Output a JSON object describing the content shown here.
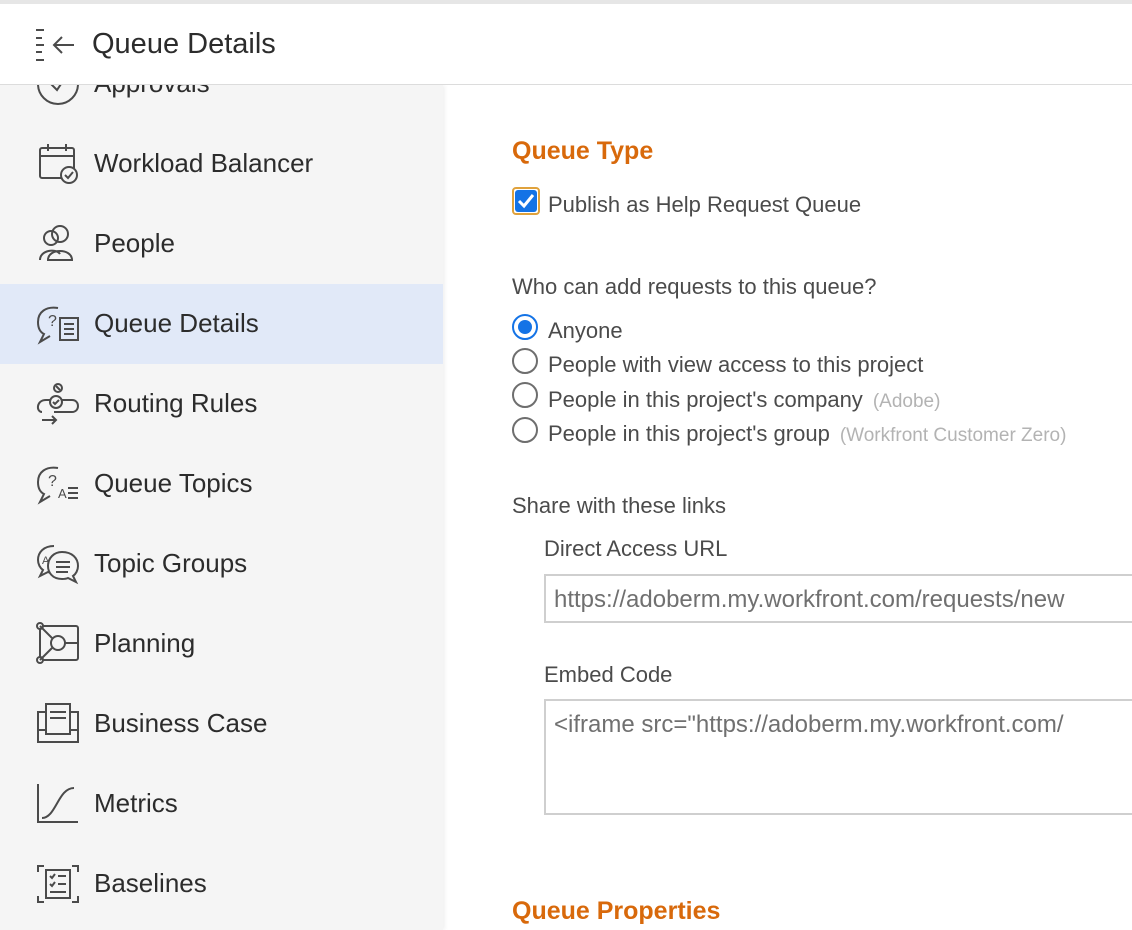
{
  "header": {
    "title": "Queue Details"
  },
  "sidebar": {
    "items": [
      {
        "label": "Approvals",
        "icon": "approvals-icon"
      },
      {
        "label": "Workload Balancer",
        "icon": "calendar-check-icon"
      },
      {
        "label": "People",
        "icon": "people-icon"
      },
      {
        "label": "Queue Details",
        "icon": "queue-details-icon",
        "active": true
      },
      {
        "label": "Routing Rules",
        "icon": "routing-rules-icon"
      },
      {
        "label": "Queue Topics",
        "icon": "queue-topics-icon"
      },
      {
        "label": "Topic Groups",
        "icon": "topic-groups-icon"
      },
      {
        "label": "Planning",
        "icon": "planning-icon"
      },
      {
        "label": "Business Case",
        "icon": "business-case-icon"
      },
      {
        "label": "Metrics",
        "icon": "metrics-icon"
      },
      {
        "label": "Baselines",
        "icon": "baselines-icon"
      }
    ]
  },
  "queue_type": {
    "title": "Queue Type",
    "publish_label": "Publish as Help Request Queue",
    "publish_checked": true
  },
  "access": {
    "question": "Who can add requests to this queue?",
    "options": [
      {
        "label": "Anyone",
        "hint": "",
        "selected": true
      },
      {
        "label": "People with view access to this project",
        "hint": "",
        "selected": false
      },
      {
        "label": "People in this project's company",
        "hint": "(Adobe)",
        "selected": false
      },
      {
        "label": "People in this project's group",
        "hint": "(Workfront Customer Zero)",
        "selected": false
      }
    ]
  },
  "share": {
    "title": "Share with these links",
    "direct_label": "Direct Access URL",
    "direct_value": "https://adoberm.my.workfront.com/requests/new",
    "embed_label": "Embed Code",
    "embed_value": "<iframe src=\"https://adoberm.my.workfront.com/"
  },
  "queue_properties": {
    "title": "Queue Properties"
  },
  "colors": {
    "accent_orange": "#d8690b",
    "selection_blue": "#1473e6",
    "active_nav_bg": "#e1e9f8"
  }
}
